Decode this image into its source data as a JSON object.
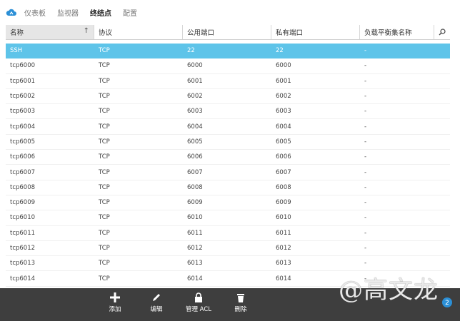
{
  "nav": {
    "tabs": [
      {
        "label": "仪表板"
      },
      {
        "label": "监视器"
      },
      {
        "label": "终结点"
      },
      {
        "label": "配置"
      }
    ],
    "active_index": 2
  },
  "table": {
    "columns": [
      "名称",
      "协议",
      "公用端口",
      "私有端口",
      "负载平衡集名称"
    ],
    "rows": [
      [
        "SSH",
        "TCP",
        "22",
        "22",
        "-"
      ],
      [
        "tcp6000",
        "TCP",
        "6000",
        "6000",
        "-"
      ],
      [
        "tcp6001",
        "TCP",
        "6001",
        "6001",
        "-"
      ],
      [
        "tcp6002",
        "TCP",
        "6002",
        "6002",
        "-"
      ],
      [
        "tcp6003",
        "TCP",
        "6003",
        "6003",
        "-"
      ],
      [
        "tcp6004",
        "TCP",
        "6004",
        "6004",
        "-"
      ],
      [
        "tcp6005",
        "TCP",
        "6005",
        "6005",
        "-"
      ],
      [
        "tcp6006",
        "TCP",
        "6006",
        "6006",
        "-"
      ],
      [
        "tcp6007",
        "TCP",
        "6007",
        "6007",
        "-"
      ],
      [
        "tcp6008",
        "TCP",
        "6008",
        "6008",
        "-"
      ],
      [
        "tcp6009",
        "TCP",
        "6009",
        "6009",
        "-"
      ],
      [
        "tcp6010",
        "TCP",
        "6010",
        "6010",
        "-"
      ],
      [
        "tcp6011",
        "TCP",
        "6011",
        "6011",
        "-"
      ],
      [
        "tcp6012",
        "TCP",
        "6012",
        "6012",
        "-"
      ],
      [
        "tcp6013",
        "TCP",
        "6013",
        "6013",
        "-"
      ],
      [
        "tcp6014",
        "TCP",
        "6014",
        "6014",
        "-"
      ]
    ],
    "selected_index": 0
  },
  "footer": {
    "actions": [
      {
        "label": "添加",
        "icon": "plus-icon"
      },
      {
        "label": "编辑",
        "icon": "pencil-icon"
      },
      {
        "label": "管理 ACL",
        "icon": "lock-icon"
      },
      {
        "label": "删除",
        "icon": "trash-icon"
      }
    ]
  },
  "watermark": "@高文龙",
  "colors": {
    "selected_row": "#5ec4e9",
    "footer_bg": "#3e3e3e",
    "header_first_bg": "#e6e6e6"
  }
}
